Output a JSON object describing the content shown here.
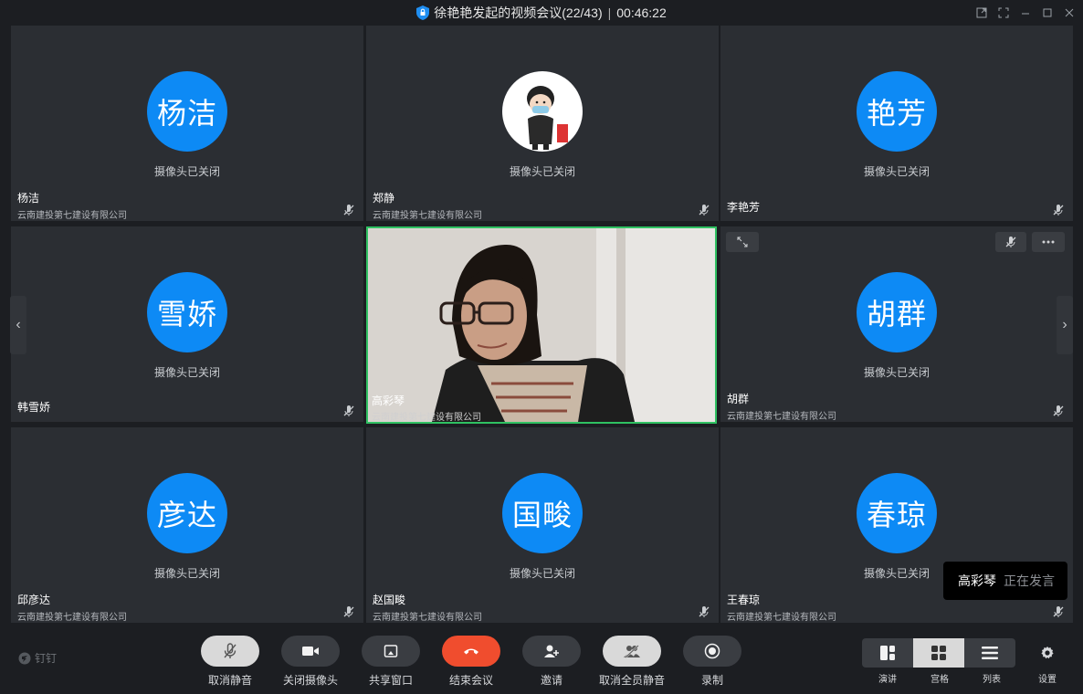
{
  "title": {
    "meeting": "徐艳艳发起的视频会议(22/43)",
    "separator": "|",
    "timer": "00:46:22"
  },
  "camera_off_text": "摄像头已关闭",
  "tiles": [
    {
      "avatar_text": "杨洁",
      "name": "杨洁",
      "org": "云南建投第七建设有限公司"
    },
    {
      "avatar_text": "",
      "name": "郑静",
      "org": "云南建投第七建设有限公司"
    },
    {
      "avatar_text": "艳芳",
      "name": "李艳芳",
      "org": ""
    },
    {
      "avatar_text": "雪娇",
      "name": "韩雪娇",
      "org": ""
    },
    {
      "avatar_text": "",
      "name": "高彩琴",
      "org": "云南建投第七建设有限公司"
    },
    {
      "avatar_text": "胡群",
      "name": "胡群",
      "org": "云南建投第七建设有限公司"
    },
    {
      "avatar_text": "彦达",
      "name": "邱彦达",
      "org": "云南建投第七建设有限公司"
    },
    {
      "avatar_text": "国畯",
      "name": "赵国畯",
      "org": "云南建投第七建设有限公司"
    },
    {
      "avatar_text": "春琼",
      "name": "王春琼",
      "org": "云南建投第七建设有限公司"
    }
  ],
  "speaking": {
    "name": "高彩琴",
    "status": "正在发言"
  },
  "brand": "钉钉",
  "toolbar": {
    "unmute": "取消静音",
    "camera_off": "关闭摄像头",
    "share": "共享窗口",
    "end": "结束会议",
    "invite": "邀请",
    "unmute_all": "取消全员静音",
    "record": "录制",
    "layout_speaker": "演讲",
    "layout_grid": "宫格",
    "layout_list": "列表",
    "settings": "设置"
  },
  "colors": {
    "avatar": "#0d8af5",
    "end_call": "#f04d2e",
    "active_speaker_border": "#2fc162"
  }
}
